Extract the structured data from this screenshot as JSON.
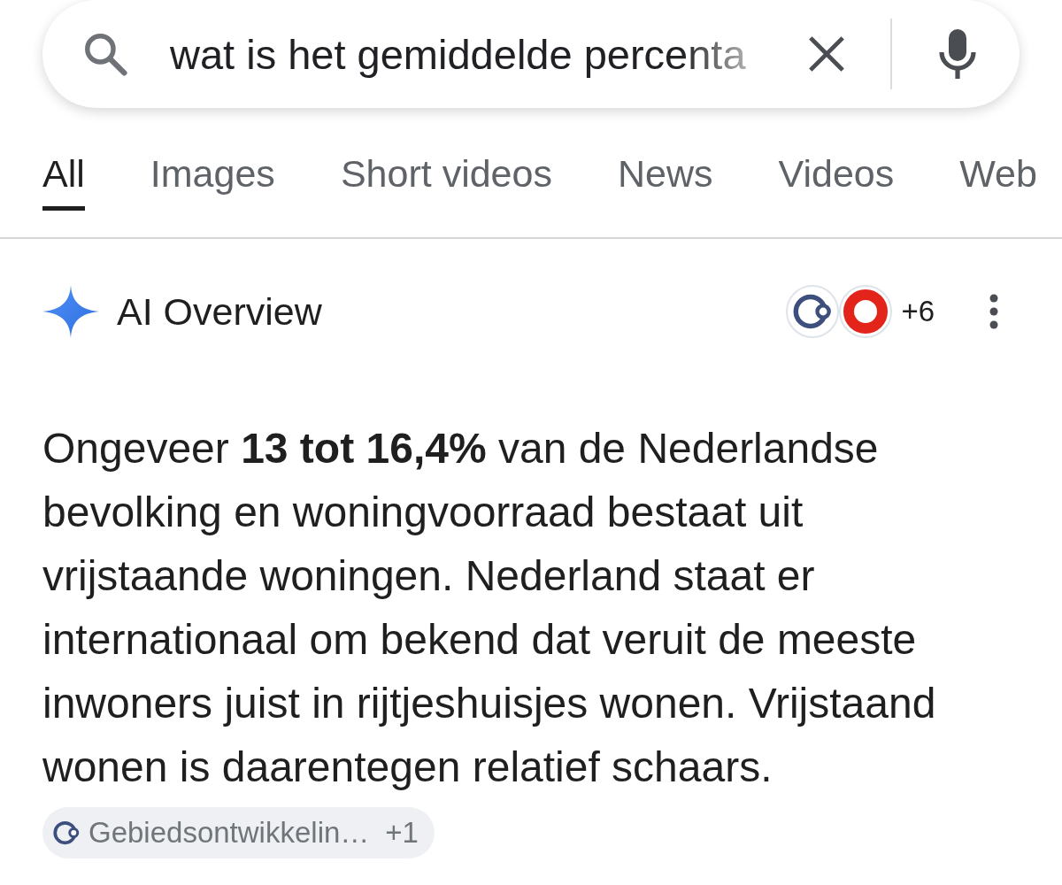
{
  "search": {
    "value": "wat is het gemiddelde percenta"
  },
  "tabs": [
    {
      "label": "All",
      "selected": true
    },
    {
      "label": "Images",
      "selected": false
    },
    {
      "label": "Short videos",
      "selected": false
    },
    {
      "label": "News",
      "selected": false
    },
    {
      "label": "Videos",
      "selected": false
    },
    {
      "label": "Web",
      "selected": false
    }
  ],
  "ai_overview": {
    "title": "AI Overview",
    "sources_more": "+6",
    "text": "Ongeveer **13 tot 16,4%** van de Nederlandse bevolking en woningvoorraad bestaat uit vrijstaande woningen. Nederland staat er internationaal om bekend dat veruit de meeste inwoners juist in rijtjeshuisjes wonen. Vrijstaand wonen is daarentegen relatief schaars.",
    "citation": {
      "label": "Gebiedsontwikkelin…",
      "more": "+1"
    }
  }
}
